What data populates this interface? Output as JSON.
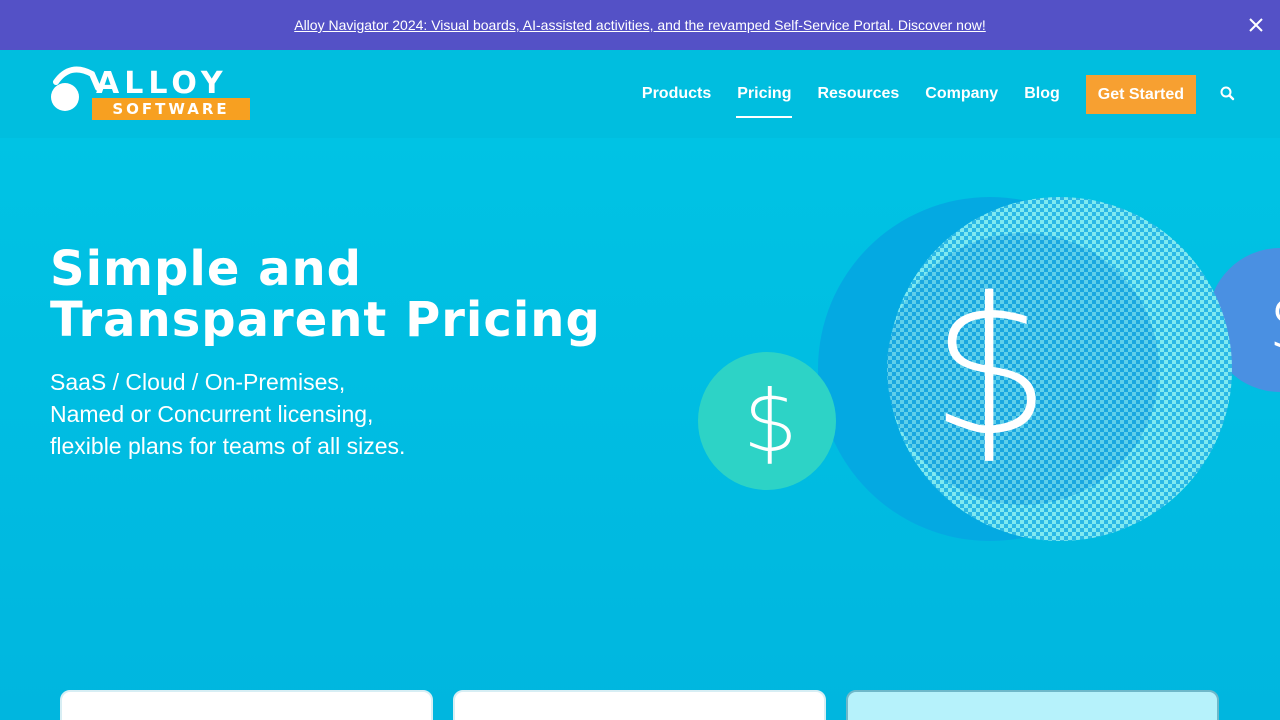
{
  "announcement": {
    "text": "Alloy Navigator 2024: Visual boards, AI-assisted activities, and the revamped Self-Service Portal. Discover now!",
    "close_icon": "close-icon"
  },
  "header": {
    "logo": {
      "top": "ALLOY",
      "bottom": "SOFTWARE"
    },
    "nav": [
      {
        "label": "Products"
      },
      {
        "label": "Pricing",
        "active": true
      },
      {
        "label": "Resources"
      },
      {
        "label": "Company"
      },
      {
        "label": "Blog"
      }
    ],
    "cta_label": "Get Started",
    "search_icon": "search-icon"
  },
  "hero": {
    "title_line1": "Simple and",
    "title_line2": "Transparent Pricing",
    "sub_line1": "SaaS / Cloud / On-Premises,",
    "sub_line2": "Named or Concurrent licensing,",
    "sub_line3": "flexible plans for teams of all sizes.",
    "art_symbol": "$"
  },
  "colors": {
    "announce_bg": "#5451c6",
    "header_bg": "#00bedf",
    "accent_orange": "#f7a031",
    "teal_coin": "#2dd3c6",
    "blue_coin": "#4a90e2"
  }
}
